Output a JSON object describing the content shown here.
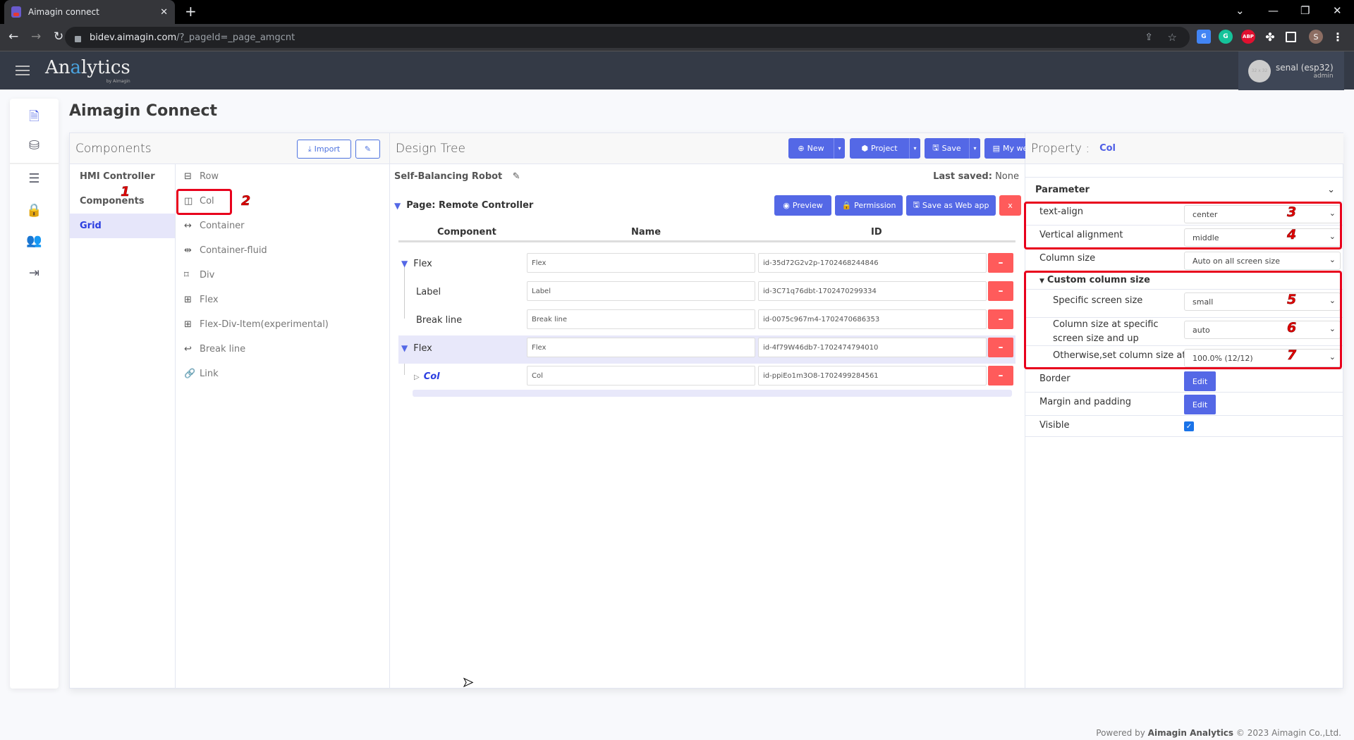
{
  "browser": {
    "tab_title": "Aimagin connect",
    "url_host": "bidev.aimagin.com",
    "url_path": "/?_pageId=_page_amgcnt",
    "extensions": [
      "google-translate",
      "grammarly",
      "adblock-plus",
      "extensions",
      "side-panel"
    ],
    "profile_initial": "S"
  },
  "header": {
    "logo_prefix": "An",
    "logo_accent": "a",
    "logo_suffix": "lytics",
    "logo_by": "by Aimagin",
    "user_name": "senal (esp32)",
    "user_role": "admin",
    "avatar_placeholder": "32 x 32"
  },
  "sidebar_icons": [
    "code-file-icon",
    "database-icon",
    "server-icon",
    "lock-icon",
    "users-icon",
    "logout-icon"
  ],
  "page_title": "Aimagin Connect",
  "components": {
    "title": "Components",
    "import_label": "Import",
    "categories": [
      {
        "label": "HMI Controller",
        "active": false
      },
      {
        "label": "Components",
        "active": false
      },
      {
        "label": "Grid",
        "active": true
      }
    ],
    "items": [
      {
        "label": "Row",
        "icon": "row-icon"
      },
      {
        "label": "Col",
        "icon": "col-icon"
      },
      {
        "label": "Container",
        "icon": "container-icon"
      },
      {
        "label": "Container-fluid",
        "icon": "container-fluid-icon"
      },
      {
        "label": "Div",
        "icon": "div-icon"
      },
      {
        "label": "Flex",
        "icon": "flex-icon"
      },
      {
        "label": "Flex-Div-Item(experimental)",
        "icon": "flex-div-item-icon"
      },
      {
        "label": "Break line",
        "icon": "break-line-icon"
      },
      {
        "label": "Link",
        "icon": "link-icon"
      }
    ]
  },
  "design_tree": {
    "title": "Design Tree",
    "toolbar": {
      "new_label": "New",
      "project_label": "Project",
      "save_label": "Save",
      "my_web_app_label": "My web app"
    },
    "project_name": "Self-Balancing Robot",
    "last_saved_label": "Last saved:",
    "last_saved_value": "None",
    "page_label": "Page: Remote Controller",
    "page_buttons": {
      "preview_label": "Preview",
      "permission_label": "Permission",
      "save_as_web_app_label": "Save as Web app",
      "close_label": "x"
    },
    "columns": [
      "Component",
      "Name",
      "ID"
    ],
    "rows": [
      {
        "component": "Flex",
        "name": "Flex",
        "id": "id-35d72G2v2p-1702468244846",
        "expanded": true,
        "level": 0
      },
      {
        "component": "Label",
        "name": "Label",
        "id": "id-3C71q76dbt-1702470299334",
        "level": 1
      },
      {
        "component": "Break line",
        "name": "Break line",
        "id": "id-0075c967m4-1702470686353",
        "level": 1
      },
      {
        "component": "Flex",
        "name": "Flex",
        "id": "id-4f79W46db7-1702474794010",
        "expanded": true,
        "level": 0,
        "highlighted": true
      },
      {
        "component": "Col",
        "name": "Col",
        "id": "id-ppiEo1m3O8-1702499284561",
        "level": 1,
        "selected": true
      }
    ]
  },
  "property": {
    "title": "Property :",
    "target": "Col",
    "section": "Parameter",
    "text_align_label": "text-align",
    "text_align_value": "center",
    "vertical_alignment_label": "Vertical alignment",
    "vertical_alignment_value": "middle",
    "column_size_label": "Column size",
    "column_size_value": "Auto on all screen size",
    "custom_column_size_label": "Custom column size",
    "specific_screen_size_label": "Specific screen size",
    "specific_screen_size_value": "small",
    "column_size_at_label": "Column size at specific screen size and up",
    "column_size_at_value": "auto",
    "otherwise_label": "Otherwise,set column size at",
    "otherwise_value": "100.0% (12/12)",
    "border_label": "Border",
    "margin_padding_label": "Margin and padding",
    "edit_label": "Edit",
    "visible_label": "Visible",
    "visible_checked": true
  },
  "annotations": [
    "1",
    "2",
    "3",
    "4",
    "5",
    "6",
    "7"
  ],
  "footer": {
    "prefix": "Powered by",
    "brand": "Aimagin Analytics",
    "suffix": "© 2023 Aimagin Co.,Ltd."
  }
}
